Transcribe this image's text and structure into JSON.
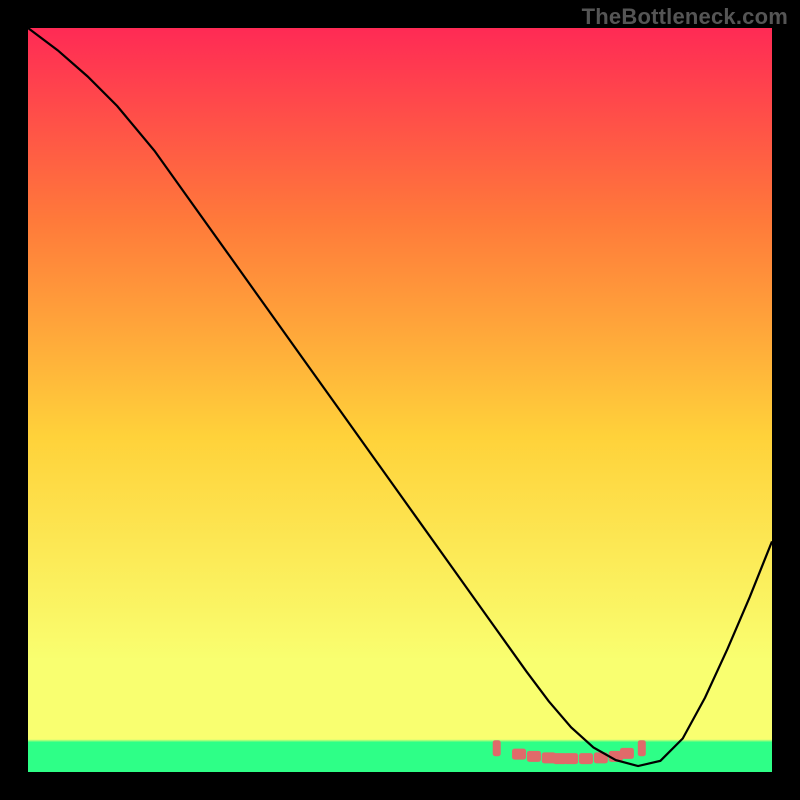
{
  "watermark": "TheBottleneck.com",
  "chart_data": {
    "type": "line",
    "title": "",
    "xlabel": "",
    "ylabel": "",
    "xlim": [
      0,
      100
    ],
    "ylim": [
      0,
      100
    ],
    "background_gradient": {
      "top": "#ff2a55",
      "upper_mid": "#ff7a3a",
      "mid": "#ffd23a",
      "lower_mid": "#f9ff70",
      "bottom_band": "#2eff87"
    },
    "series": [
      {
        "name": "curve",
        "color": "#000000",
        "x": [
          0,
          4,
          8,
          12,
          17,
          22,
          27,
          32,
          37,
          42,
          47,
          52,
          57,
          62,
          64,
          67,
          70,
          73,
          76,
          79,
          82,
          85,
          88,
          91,
          94,
          97,
          100
        ],
        "y": [
          100,
          97,
          93.5,
          89.5,
          83.5,
          76.5,
          69.5,
          62.5,
          55.5,
          48.5,
          41.5,
          34.5,
          27.5,
          20.5,
          17.7,
          13.5,
          9.5,
          6.0,
          3.3,
          1.6,
          0.8,
          1.5,
          4.5,
          10.0,
          16.5,
          23.5,
          31.0
        ]
      },
      {
        "name": "optimum-band-markers",
        "color": "#e06a6a",
        "marker_style": "rough-rect",
        "x": [
          63,
          66,
          68,
          70,
          71.5,
          73,
          75,
          77,
          79,
          80.5,
          82.5
        ],
        "y": [
          3.2,
          2.4,
          2.1,
          1.9,
          1.8,
          1.8,
          1.8,
          1.9,
          2.1,
          2.5,
          3.2
        ]
      }
    ],
    "green_band_y_range": [
      0,
      4.0
    ]
  }
}
